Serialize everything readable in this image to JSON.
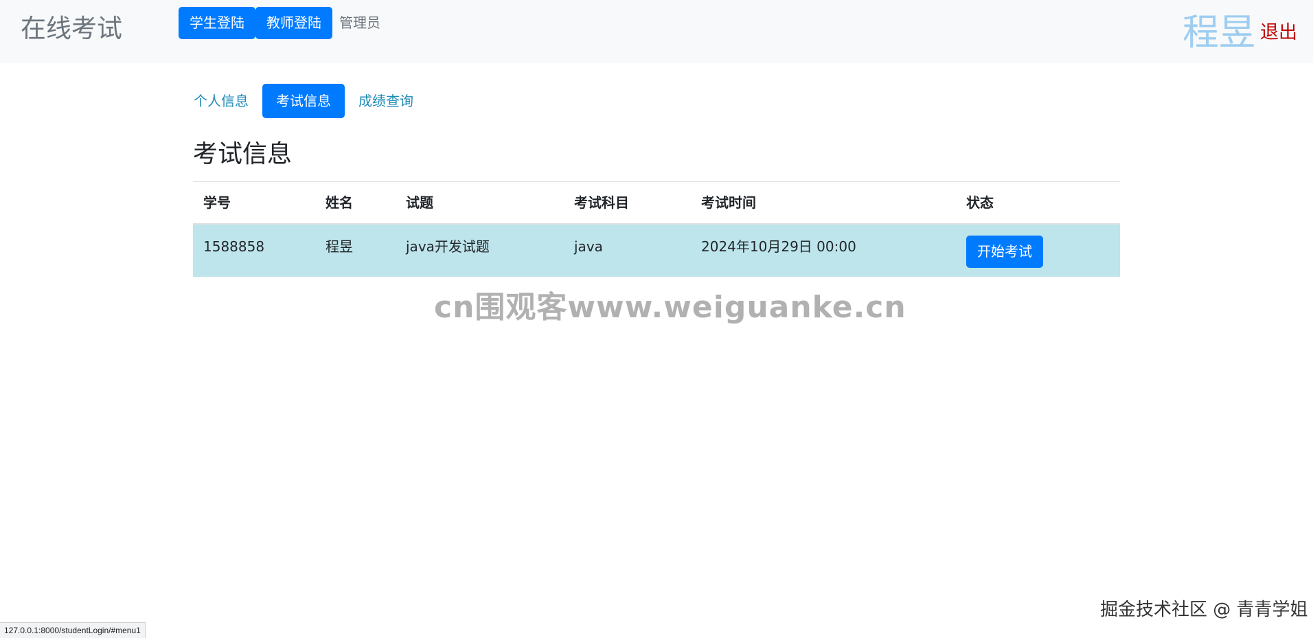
{
  "navbar": {
    "brand": "在线考试",
    "student_login": "学生登陆",
    "teacher_login": "教师登陆",
    "admin": "管理员",
    "user_name": "程昱",
    "logout": "退出"
  },
  "tabs": [
    {
      "label": "个人信息",
      "active": false
    },
    {
      "label": "考试信息",
      "active": true
    },
    {
      "label": "成绩查询",
      "active": false
    }
  ],
  "page_title": "考试信息",
  "table": {
    "headers": [
      "学号",
      "姓名",
      "试题",
      "考试科目",
      "考试时间",
      "状态"
    ],
    "rows": [
      {
        "student_id": "1588858",
        "name": "程昱",
        "exam_paper": "java开发试题",
        "subject": "java",
        "exam_time": "2024年10月29日 00:00",
        "action": "开始考试"
      }
    ]
  },
  "watermarks": {
    "center": "cn围观客www.weiguanke.cn",
    "corner": "掘金技术社区 @ 青青学姐"
  },
  "status_url": "127.0.0.1:8000/studentLogin/#menu1",
  "colors": {
    "primary": "#007bff",
    "navbar_bg": "#f8f9fa",
    "row_highlight": "#bee5eb",
    "logout": "#c00000",
    "user_name": "#9ecdf0",
    "tab_link": "#1f8ab6"
  }
}
